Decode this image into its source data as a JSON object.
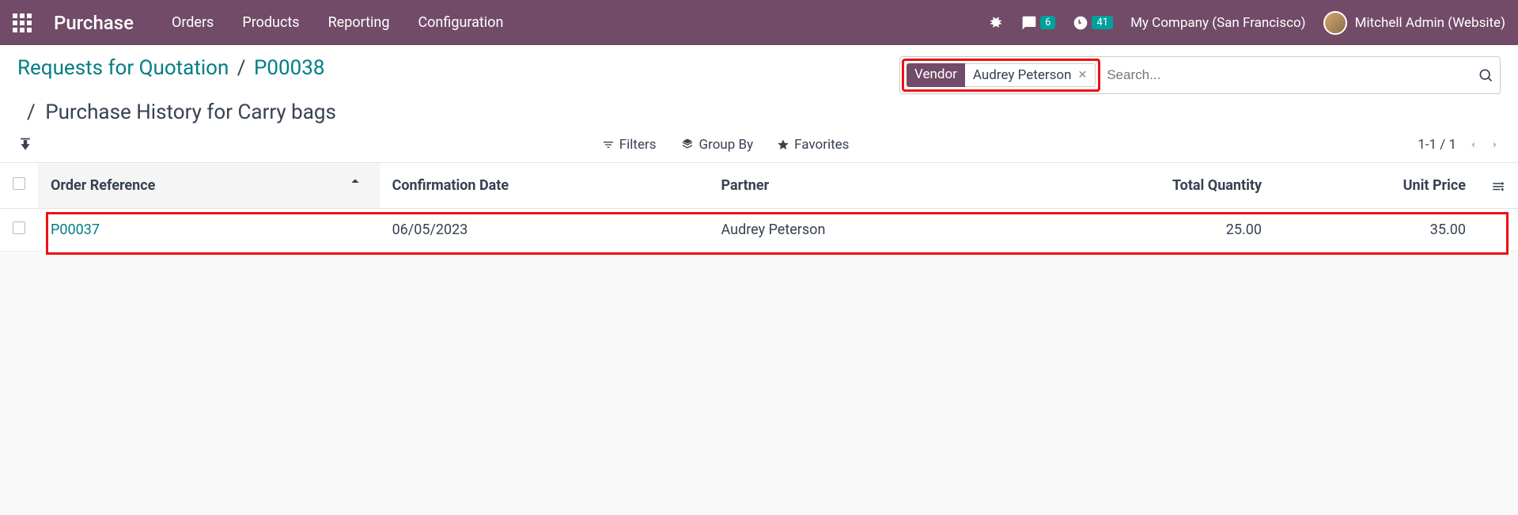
{
  "navbar": {
    "app_name": "Purchase",
    "menu": [
      "Orders",
      "Products",
      "Reporting",
      "Configuration"
    ],
    "messages_badge": "6",
    "activities_badge": "41",
    "company": "My Company (San Francisco)",
    "user": "Mitchell Admin (Website)"
  },
  "breadcrumb": {
    "root": "Requests for Quotation",
    "po": "P00038",
    "subtitle": "Purchase History for Carry bags"
  },
  "search": {
    "tag_label": "Vendor",
    "tag_value": "Audrey Peterson",
    "placeholder": "Search..."
  },
  "toolbar": {
    "filters": "Filters",
    "groupby": "Group By",
    "favorites": "Favorites",
    "pager": "1-1 / 1"
  },
  "table": {
    "headers": {
      "order_ref": "Order Reference",
      "conf_date": "Confirmation Date",
      "partner": "Partner",
      "qty": "Total Quantity",
      "price": "Unit Price"
    },
    "rows": [
      {
        "order_ref": "P00037",
        "conf_date": "06/05/2023",
        "partner": "Audrey Peterson",
        "qty": "25.00",
        "price": "35.00"
      }
    ]
  }
}
